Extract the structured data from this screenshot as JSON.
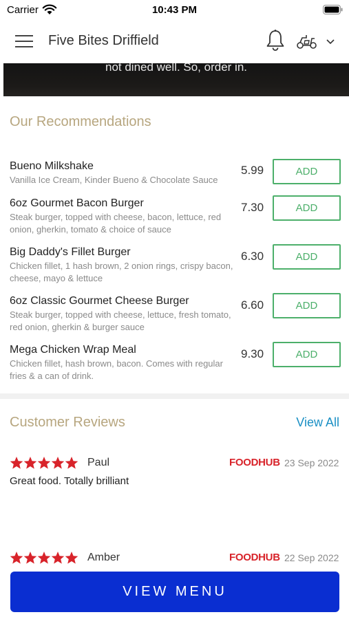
{
  "status_bar": {
    "carrier": "Carrier",
    "time": "10:43 PM"
  },
  "header": {
    "title": "Five Bites Driffield",
    "icons": [
      "menu-icon",
      "bell-icon",
      "scooter-icon",
      "chevron-down-icon"
    ]
  },
  "banner": {
    "text": "not dined well. So, order in."
  },
  "recommendations": {
    "title": "Our Recommendations",
    "add_label": "ADD",
    "items": [
      {
        "name": "Bueno Milkshake",
        "description": "Vanilla Ice Cream, Kinder Bueno & Chocolate Sauce",
        "price": "5.99"
      },
      {
        "name": "6oz Gourmet Bacon Burger",
        "description": "Steak burger, topped with cheese, bacon, lettuce, red onion, gherkin, tomato & choice of sauce",
        "price": "7.30"
      },
      {
        "name": "Big Daddy's Fillet Burger",
        "description": "Chicken fillet, 1 hash brown, 2 onion rings, crispy bacon, cheese, mayo & lettuce",
        "price": "6.30"
      },
      {
        "name": "6oz Classic Gourmet Cheese Burger",
        "description": "Steak burger, topped with cheese, lettuce, fresh tomato, red onion, gherkin & burger sauce",
        "price": "6.60"
      },
      {
        "name": "Mega Chicken Wrap Meal",
        "description": "Chicken fillet, hash brown, bacon. Comes with regular fries & a can of drink.",
        "price": "9.30"
      }
    ]
  },
  "reviews": {
    "title": "Customer Reviews",
    "view_all": "View All",
    "items": [
      {
        "name": "Paul",
        "rating": 5,
        "source": "FOODHUB",
        "date": "23 Sep 2022",
        "text": "Great food. Totally brilliant"
      },
      {
        "name": "Amber",
        "rating": 5,
        "source": "FOODHUB",
        "date": "22 Sep 2022",
        "text": ""
      }
    ]
  },
  "footer": {
    "view_menu": "VIEW MENU"
  },
  "colors": {
    "accent_gold": "#b7a67f",
    "add_green": "#4caf6a",
    "link_blue": "#1a8fc4",
    "star_red": "#d8232a",
    "button_blue": "#0a2ed1"
  }
}
